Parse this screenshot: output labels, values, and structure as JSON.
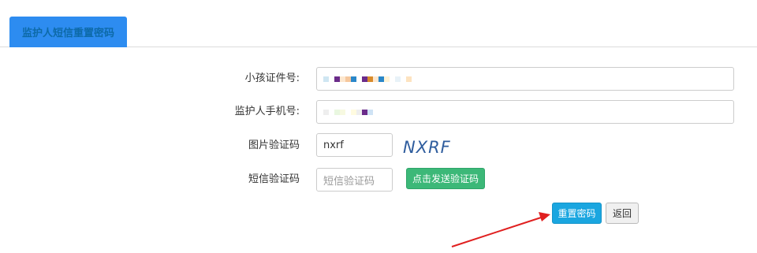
{
  "tab": {
    "label": "监护人短信重置密码"
  },
  "form": {
    "child_id_label": "小孩证件号:",
    "guardian_phone_label": "监护人手机号:",
    "image_captcha_label": "图片验证码",
    "image_captcha_value": "nxrf",
    "captcha_image_text": "NXRF",
    "sms_code_label": "短信验证码",
    "sms_code_placeholder": "短信验证码",
    "send_code_button": "点击发送验证码"
  },
  "actions": {
    "reset_button": "重置密码",
    "back_button": "返回"
  },
  "colors": {
    "tab": "#2d8cf0",
    "send_button": "#3cb878",
    "reset_button": "#1aa6e0",
    "annotation_arrow": "#e02020"
  },
  "annotation": {
    "shape": "red arrow pointing to reset button"
  }
}
